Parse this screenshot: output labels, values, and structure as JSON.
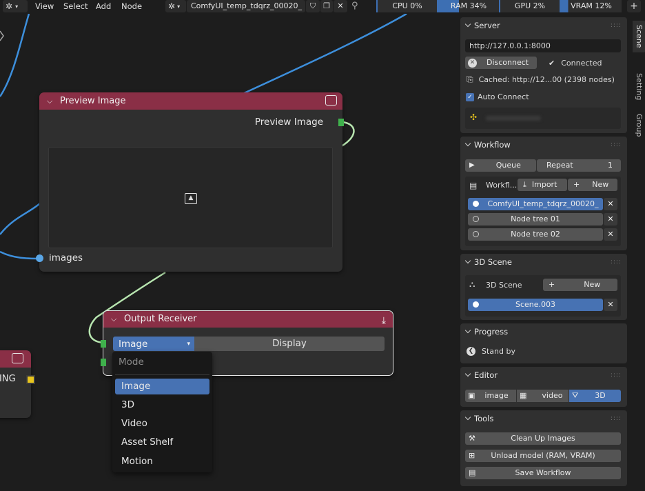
{
  "header": {
    "menus": [
      "View",
      "Select",
      "Add",
      "Node"
    ],
    "workflow_name": "ComfyUI_temp_tdqrz_00020_",
    "stats": [
      {
        "label": "CPU 0%",
        "value": 0
      },
      {
        "label": "RAM 34%",
        "value": 34
      },
      {
        "label": "GPU 2%",
        "value": 2
      },
      {
        "label": "VRAM 12%",
        "value": 12
      }
    ],
    "add_symbol": "+"
  },
  "nodes": {
    "preview": {
      "title": "Preview Image",
      "output_label": "Preview Image",
      "input_label": "images"
    },
    "receiver": {
      "title": "Output Receiver",
      "mode_value": "Image",
      "display_label": "Display"
    },
    "partial": {
      "label": "RING"
    }
  },
  "dropdown": {
    "title": "Mode",
    "items": [
      "Image",
      "3D",
      "Video",
      "Asset Shelf",
      "Motion"
    ],
    "selected": "Image"
  },
  "sidebar": {
    "tabs": [
      "Scene",
      "Setting",
      "Group"
    ],
    "server": {
      "title": "Server",
      "url": "http://127.0.0.1:8000",
      "disconnect_label": "Disconnect",
      "status": "Connected",
      "cached": "Cached: http://12...00  (2398 nodes)",
      "auto_connect": "Auto Connect"
    },
    "workflow": {
      "title": "Workflow",
      "queue_label": "Queue",
      "repeat_label": "Repeat",
      "repeat_value": "1",
      "workflows_label": "Workfl...",
      "import_label": "Import",
      "new_label": "New",
      "items": [
        {
          "name": "ComfyUI_temp_tdqrz_00020_",
          "active": true
        },
        {
          "name": "Node tree 01",
          "active": false
        },
        {
          "name": "Node tree 02",
          "active": false
        }
      ]
    },
    "scene3d": {
      "title": "3D Scene",
      "label": "3D Scene",
      "new_label": "New",
      "item": "Scene.003"
    },
    "progress": {
      "title": "Progress",
      "status": "Stand by"
    },
    "editor": {
      "title": "Editor",
      "modes": [
        "image",
        "video",
        "3D"
      ],
      "active": "3D"
    },
    "tools": {
      "title": "Tools",
      "buttons": [
        "Clean Up Images",
        "Unload model (RAM, VRAM)",
        "Save Workflow"
      ]
    }
  },
  "colors": {
    "node_header": "#8a2f46",
    "accent_blue": "#4772b3",
    "socket_green": "#3fb14c",
    "wire_blue": "#3d8fdc",
    "wire_green": "#b8e6b0",
    "socket_yellow": "#e8c51e"
  }
}
